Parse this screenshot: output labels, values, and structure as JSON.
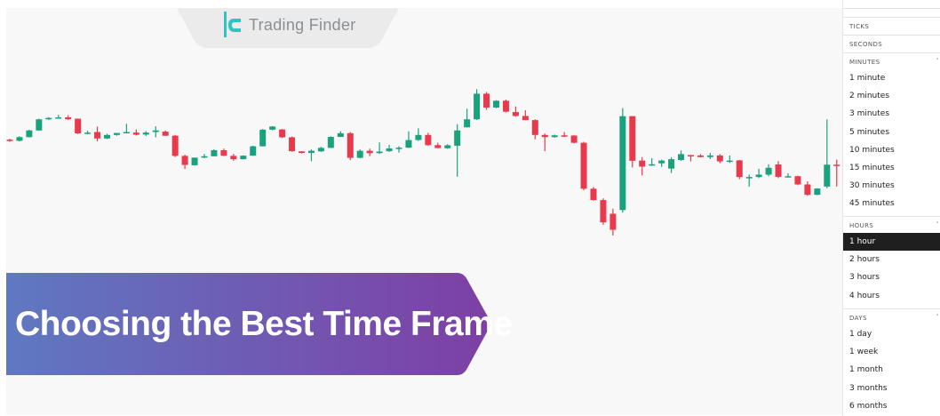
{
  "brand": {
    "name": "Trading Finder"
  },
  "banner": {
    "title": "Choosing the Best Time Frame"
  },
  "timeframe_menu": {
    "sections": [
      {
        "header": "TICKS",
        "items": []
      },
      {
        "header": "SECONDS",
        "items": []
      },
      {
        "header": "MINUTES",
        "items": [
          "1 minute",
          "2 minutes",
          "3 minutes",
          "5 minutes",
          "10 minutes",
          "15 minutes",
          "30 minutes",
          "45 minutes"
        ]
      },
      {
        "header": "HOURS",
        "items": [
          "1 hour",
          "2 hours",
          "3 hours",
          "4 hours"
        ]
      },
      {
        "header": "DAYS",
        "items": [
          "1 day",
          "1 week",
          "1 month",
          "3 months",
          "6 months"
        ]
      }
    ],
    "selected": "1 hour"
  },
  "colors": {
    "up": "#1aa17d",
    "down": "#e8394d",
    "banner_start": "#5f79c1",
    "banner_end": "#7e3fa4",
    "logo_accent": "#2ec4c0"
  },
  "chart_data": {
    "type": "candlestick",
    "y_scale": "unlabeled",
    "candles": [
      {
        "o": 64.5,
        "h": 64.9,
        "l": 63.4,
        "c": 63.9
      },
      {
        "o": 63.9,
        "h": 66.2,
        "l": 63.6,
        "c": 65.8
      },
      {
        "o": 65.8,
        "h": 69.5,
        "l": 65.6,
        "c": 69.2
      },
      {
        "o": 69.2,
        "h": 75.2,
        "l": 69.0,
        "c": 74.9
      },
      {
        "o": 74.9,
        "h": 76.0,
        "l": 74.6,
        "c": 75.6
      },
      {
        "o": 75.6,
        "h": 77.2,
        "l": 75.2,
        "c": 75.9
      },
      {
        "o": 75.9,
        "h": 77.0,
        "l": 74.6,
        "c": 74.9
      },
      {
        "o": 75.2,
        "h": 75.3,
        "l": 67.4,
        "c": 67.7
      },
      {
        "o": 67.7,
        "h": 69.1,
        "l": 67.3,
        "c": 68.1
      },
      {
        "o": 68.4,
        "h": 71.2,
        "l": 63.7,
        "c": 65.1
      },
      {
        "o": 65.1,
        "h": 67.5,
        "l": 64.8,
        "c": 66.9
      },
      {
        "o": 66.9,
        "h": 67.9,
        "l": 66.5,
        "c": 67.9
      },
      {
        "o": 68.1,
        "h": 72.6,
        "l": 68.1,
        "c": 68.4
      },
      {
        "o": 68.1,
        "h": 69.7,
        "l": 66.6,
        "c": 67.0
      },
      {
        "o": 67.1,
        "h": 68.9,
        "l": 66.4,
        "c": 68.1
      },
      {
        "o": 68.4,
        "h": 71.3,
        "l": 65.7,
        "c": 69.2
      },
      {
        "o": 68.6,
        "h": 69.2,
        "l": 66.5,
        "c": 66.5
      },
      {
        "o": 66.5,
        "h": 66.9,
        "l": 55.6,
        "c": 56.2
      },
      {
        "o": 56.2,
        "h": 56.8,
        "l": 49.5,
        "c": 51.6
      },
      {
        "o": 51.4,
        "h": 55.3,
        "l": 51.2,
        "c": 55.3
      },
      {
        "o": 55.9,
        "h": 57.2,
        "l": 55.0,
        "c": 56.0
      },
      {
        "o": 56.0,
        "h": 59.6,
        "l": 56.0,
        "c": 59.1
      },
      {
        "o": 59.1,
        "h": 59.9,
        "l": 56.1,
        "c": 56.3
      },
      {
        "o": 56.2,
        "h": 57.2,
        "l": 53.7,
        "c": 54.5
      },
      {
        "o": 54.5,
        "h": 56.5,
        "l": 54.4,
        "c": 56.3
      },
      {
        "o": 56.3,
        "h": 61.4,
        "l": 56.2,
        "c": 61.1
      },
      {
        "o": 61.1,
        "h": 69.9,
        "l": 61.0,
        "c": 69.6
      },
      {
        "o": 69.6,
        "h": 71.4,
        "l": 69.3,
        "c": 71.2
      },
      {
        "o": 69.7,
        "h": 69.9,
        "l": 65.4,
        "c": 65.7
      },
      {
        "o": 65.7,
        "h": 66.1,
        "l": 58.3,
        "c": 58.6
      },
      {
        "o": 58.5,
        "h": 58.6,
        "l": 57.4,
        "c": 57.7
      },
      {
        "o": 57.7,
        "h": 59.5,
        "l": 53.5,
        "c": 58.8
      },
      {
        "o": 58.5,
        "h": 60.8,
        "l": 58.3,
        "c": 60.3
      },
      {
        "o": 60.3,
        "h": 66.2,
        "l": 60.2,
        "c": 65.9
      },
      {
        "o": 65.9,
        "h": 68.8,
        "l": 65.8,
        "c": 67.8
      },
      {
        "o": 67.8,
        "h": 68.4,
        "l": 54.0,
        "c": 55.2
      },
      {
        "o": 55.2,
        "h": 59.5,
        "l": 55.0,
        "c": 58.8
      },
      {
        "o": 58.8,
        "h": 59.9,
        "l": 56.1,
        "c": 57.6
      },
      {
        "o": 57.6,
        "h": 63.1,
        "l": 57.2,
        "c": 58.4
      },
      {
        "o": 58.6,
        "h": 61.8,
        "l": 58.2,
        "c": 60.0
      },
      {
        "o": 60.1,
        "h": 61.1,
        "l": 57.9,
        "c": 60.4
      },
      {
        "o": 60.4,
        "h": 68.8,
        "l": 60.2,
        "c": 64.3
      },
      {
        "o": 64.3,
        "h": 70.3,
        "l": 63.9,
        "c": 66.9
      },
      {
        "o": 66.9,
        "h": 68.0,
        "l": 61.3,
        "c": 61.7
      },
      {
        "o": 61.7,
        "h": 62.9,
        "l": 60.1,
        "c": 60.2
      },
      {
        "o": 60.1,
        "h": 62.2,
        "l": 59.8,
        "c": 61.6
      },
      {
        "o": 61.4,
        "h": 72.4,
        "l": 45.5,
        "c": 69.2
      },
      {
        "o": 70.8,
        "h": 80.3,
        "l": 70.7,
        "c": 74.9
      },
      {
        "o": 74.9,
        "h": 90.3,
        "l": 74.6,
        "c": 88.0
      },
      {
        "o": 88.0,
        "h": 88.9,
        "l": 79.7,
        "c": 80.9
      },
      {
        "o": 80.9,
        "h": 84.7,
        "l": 80.6,
        "c": 84.4
      },
      {
        "o": 84.4,
        "h": 85.0,
        "l": 78.4,
        "c": 78.8
      },
      {
        "o": 78.6,
        "h": 81.5,
        "l": 76.3,
        "c": 76.6
      },
      {
        "o": 76.6,
        "h": 79.5,
        "l": 75.8,
        "c": 74.5
      },
      {
        "o": 74.5,
        "h": 74.9,
        "l": 64.7,
        "c": 66.9
      },
      {
        "o": 66.9,
        "h": 67.6,
        "l": 58.6,
        "c": 65.8
      },
      {
        "o": 65.8,
        "h": 67.1,
        "l": 65.5,
        "c": 66.7
      },
      {
        "o": 66.7,
        "h": 68.4,
        "l": 65.9,
        "c": 66.6
      },
      {
        "o": 66.6,
        "h": 66.8,
        "l": 62.6,
        "c": 62.9
      },
      {
        "o": 62.9,
        "h": 63.4,
        "l": 38.6,
        "c": 39.4
      },
      {
        "o": 39.4,
        "h": 40.3,
        "l": 33.3,
        "c": 33.6
      },
      {
        "o": 33.6,
        "h": 34.5,
        "l": 21.0,
        "c": 22.2
      },
      {
        "o": 26.6,
        "h": 29.2,
        "l": 15.5,
        "c": 18.4
      },
      {
        "o": 28.5,
        "h": 80.6,
        "l": 27.2,
        "c": 76.5
      },
      {
        "o": 76.5,
        "h": 76.4,
        "l": 50.3,
        "c": 53.7
      },
      {
        "o": 53.8,
        "h": 55.6,
        "l": 46.2,
        "c": 50.7
      },
      {
        "o": 51.5,
        "h": 55.0,
        "l": 51.1,
        "c": 51.9
      },
      {
        "o": 52.4,
        "h": 54.3,
        "l": 50.6,
        "c": 53.8
      },
      {
        "o": 49.7,
        "h": 55.5,
        "l": 47.4,
        "c": 54.5
      },
      {
        "o": 54.1,
        "h": 58.9,
        "l": 53.7,
        "c": 57.1
      },
      {
        "o": 56.6,
        "h": 56.7,
        "l": 53.4,
        "c": 56.4
      },
      {
        "o": 56.4,
        "h": 57.1,
        "l": 55.4,
        "c": 55.6
      },
      {
        "o": 55.6,
        "h": 57.7,
        "l": 54.6,
        "c": 56.4
      },
      {
        "o": 56.4,
        "h": 57.1,
        "l": 52.5,
        "c": 53.4
      },
      {
        "o": 53.4,
        "h": 56.4,
        "l": 52.6,
        "c": 53.8
      },
      {
        "o": 53.9,
        "h": 54.1,
        "l": 44.3,
        "c": 45.4
      },
      {
        "o": 45.4,
        "h": 46.6,
        "l": 40.5,
        "c": 45.4
      },
      {
        "o": 45.4,
        "h": 49.6,
        "l": 44.8,
        "c": 46.6
      },
      {
        "o": 46.6,
        "h": 51.9,
        "l": 45.8,
        "c": 50.1
      },
      {
        "o": 51.8,
        "h": 53.5,
        "l": 44.8,
        "c": 45.5
      },
      {
        "o": 45.6,
        "h": 47.3,
        "l": 45.3,
        "c": 45.8
      },
      {
        "o": 45.8,
        "h": 46.1,
        "l": 41.2,
        "c": 41.6
      },
      {
        "o": 41.6,
        "h": 43.2,
        "l": 35.8,
        "c": 36.3
      },
      {
        "o": 36.3,
        "h": 39.7,
        "l": 36.1,
        "c": 39.5
      },
      {
        "o": 40.5,
        "h": 74.8,
        "l": 39.6,
        "c": 51.7
      },
      {
        "o": 51.7,
        "h": 54.3,
        "l": 40.5,
        "c": 51.2
      }
    ]
  }
}
